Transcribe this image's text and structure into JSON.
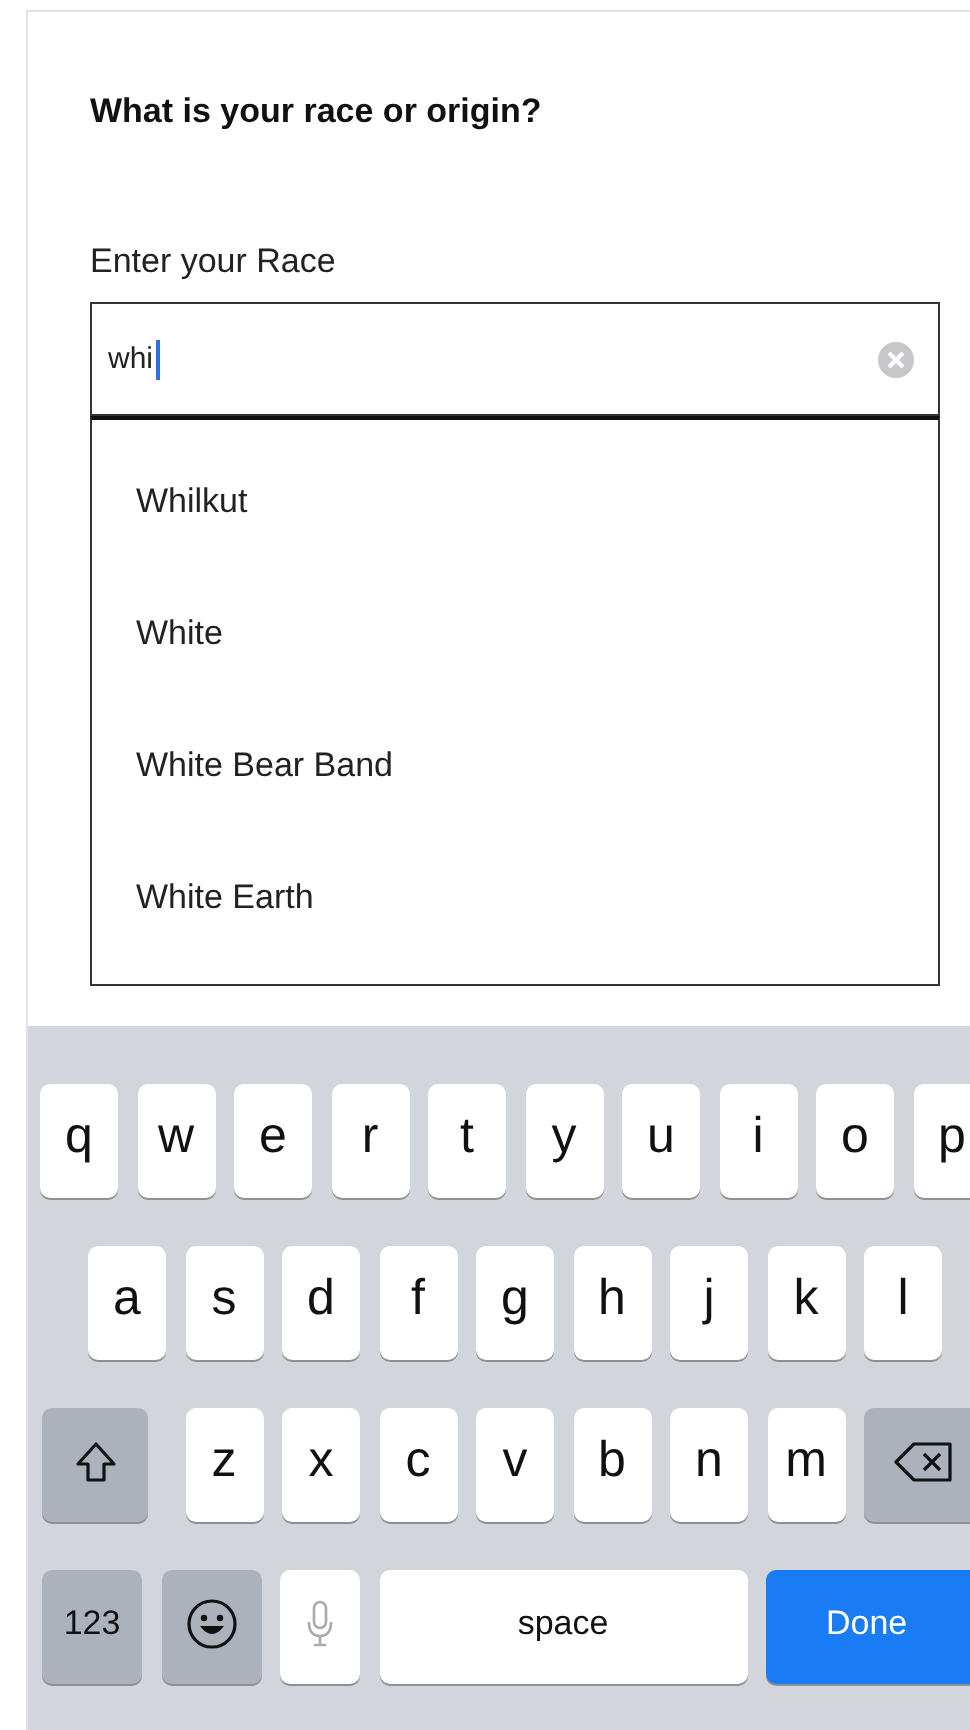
{
  "question": "What is your race or origin?",
  "field": {
    "label": "Enter your Race",
    "value": "whi"
  },
  "suggestions": [
    {
      "label": "Whilkut"
    },
    {
      "label": "White"
    },
    {
      "label": "White Bear Band"
    },
    {
      "label": "White Earth"
    }
  ],
  "keyboard": {
    "top_letters": [
      {
        "kind": "letter",
        "label": "q"
      },
      {
        "kind": "letter",
        "label": "w"
      },
      {
        "kind": "letter",
        "label": "e"
      },
      {
        "kind": "letter",
        "label": "r"
      },
      {
        "kind": "letter",
        "label": "t"
      },
      {
        "kind": "letter",
        "label": "y"
      },
      {
        "kind": "letter",
        "label": "u"
      },
      {
        "kind": "letter",
        "label": "i"
      },
      {
        "kind": "letter",
        "label": "o"
      },
      {
        "kind": "letter",
        "label": "p"
      }
    ],
    "middle_letters": [
      {
        "kind": "letter",
        "label": "a"
      },
      {
        "kind": "letter",
        "label": "s"
      },
      {
        "kind": "letter",
        "label": "d"
      },
      {
        "kind": "letter",
        "label": "f"
      },
      {
        "kind": "letter",
        "label": "g"
      },
      {
        "kind": "letter",
        "label": "h"
      },
      {
        "kind": "letter",
        "label": "j"
      },
      {
        "kind": "letter",
        "label": "k"
      },
      {
        "kind": "letter",
        "label": "l"
      }
    ],
    "bottom_letters": [
      {
        "kind": "shift"
      },
      {
        "kind": "letter",
        "label": "z"
      },
      {
        "kind": "letter",
        "label": "x"
      },
      {
        "kind": "letter",
        "label": "c"
      },
      {
        "kind": "letter",
        "label": "v"
      },
      {
        "kind": "letter",
        "label": "b"
      },
      {
        "kind": "letter",
        "label": "n"
      },
      {
        "kind": "letter",
        "label": "m"
      },
      {
        "kind": "delete"
      }
    ],
    "function_keys": [
      {
        "kind": "numbers",
        "label": "123"
      },
      {
        "kind": "emoji"
      },
      {
        "kind": "mic"
      },
      {
        "kind": "space",
        "label": "space"
      },
      {
        "kind": "done",
        "label": "Done"
      }
    ]
  }
}
